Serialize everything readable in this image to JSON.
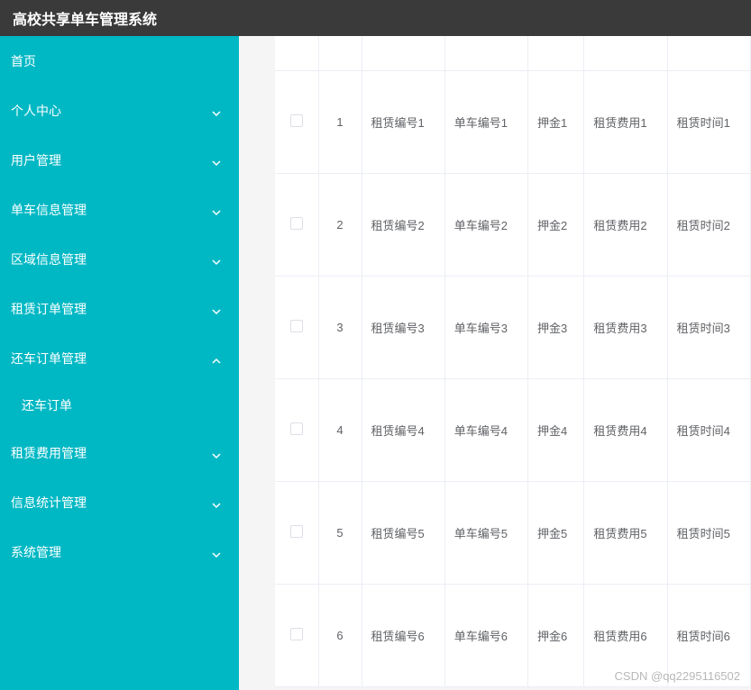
{
  "header": {
    "title": "高校共享单车管理系统"
  },
  "sidebar": {
    "items": [
      {
        "label": "首页",
        "expandable": false
      },
      {
        "label": "个人中心",
        "expandable": true,
        "expanded": false
      },
      {
        "label": "用户管理",
        "expandable": true,
        "expanded": false
      },
      {
        "label": "单车信息管理",
        "expandable": true,
        "expanded": false
      },
      {
        "label": "区域信息管理",
        "expandable": true,
        "expanded": false
      },
      {
        "label": "租赁订单管理",
        "expandable": true,
        "expanded": false
      },
      {
        "label": "还车订单管理",
        "expandable": true,
        "expanded": true,
        "children": [
          {
            "label": "还车订单"
          }
        ]
      },
      {
        "label": "租赁费用管理",
        "expandable": true,
        "expanded": false
      },
      {
        "label": "信息统计管理",
        "expandable": true,
        "expanded": false
      },
      {
        "label": "系统管理",
        "expandable": true,
        "expanded": false
      }
    ]
  },
  "table": {
    "rows": [
      {
        "seq": "1",
        "c1": "租赁编号1",
        "c2": "单车编号1",
        "c3": "押金1",
        "c4": "租赁费用1",
        "c5": "租赁时间1"
      },
      {
        "seq": "2",
        "c1": "租赁编号2",
        "c2": "单车编号2",
        "c3": "押金2",
        "c4": "租赁费用2",
        "c5": "租赁时间2"
      },
      {
        "seq": "3",
        "c1": "租赁编号3",
        "c2": "单车编号3",
        "c3": "押金3",
        "c4": "租赁费用3",
        "c5": "租赁时间3"
      },
      {
        "seq": "4",
        "c1": "租赁编号4",
        "c2": "单车编号4",
        "c3": "押金4",
        "c4": "租赁费用4",
        "c5": "租赁时间4"
      },
      {
        "seq": "5",
        "c1": "租赁编号5",
        "c2": "单车编号5",
        "c3": "押金5",
        "c4": "租赁费用5",
        "c5": "租赁时间5"
      },
      {
        "seq": "6",
        "c1": "租赁编号6",
        "c2": "单车编号6",
        "c3": "押金6",
        "c4": "租赁费用6",
        "c5": "租赁时间6"
      }
    ]
  },
  "watermark": "CSDN @qq2295116502"
}
